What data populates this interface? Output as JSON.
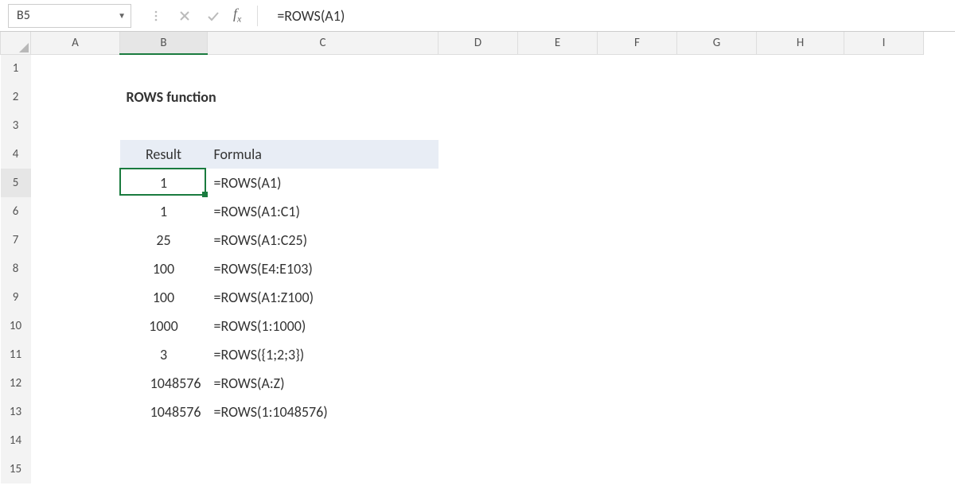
{
  "name_box": "B5",
  "formula_bar": "=ROWS(A1)",
  "columns": [
    "A",
    "B",
    "C",
    "D",
    "E",
    "F",
    "G",
    "H",
    "I"
  ],
  "row_numbers": [
    1,
    2,
    3,
    4,
    5,
    6,
    7,
    8,
    9,
    10,
    11,
    12,
    13,
    14,
    15
  ],
  "title_cell": "ROWS function",
  "table": {
    "headers": {
      "result": "Result",
      "formula": "Formula"
    },
    "rows": [
      {
        "result": "1",
        "formula": "=ROWS(A1)"
      },
      {
        "result": "1",
        "formula": "=ROWS(A1:C1)"
      },
      {
        "result": "25",
        "formula": "=ROWS(A1:C25)"
      },
      {
        "result": "100",
        "formula": "=ROWS(E4:E103)"
      },
      {
        "result": "100",
        "formula": "=ROWS(A1:Z100)"
      },
      {
        "result": "1000",
        "formula": "=ROWS(1:1000)"
      },
      {
        "result": "3",
        "formula": "=ROWS({1;2;3})"
      },
      {
        "result": "1048576",
        "formula": "=ROWS(A:Z)"
      },
      {
        "result": "1048576",
        "formula": "=ROWS(1:1048576)"
      }
    ]
  },
  "selection": {
    "cell": "B5"
  }
}
